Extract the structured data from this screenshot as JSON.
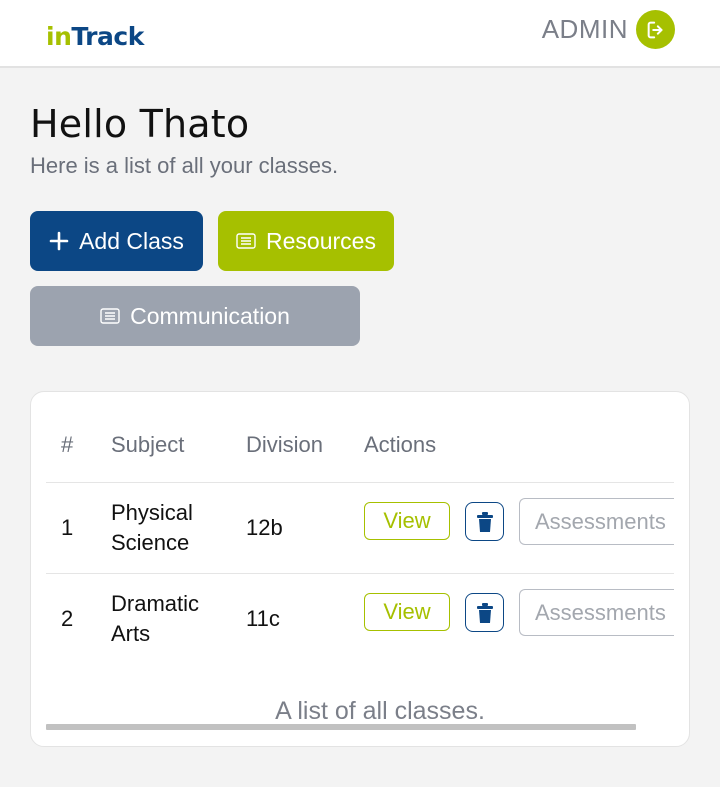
{
  "header": {
    "logo_in": "in",
    "logo_track": "Track",
    "role": "ADMIN",
    "logout_icon": "logout-icon"
  },
  "greeting": "Hello Thato",
  "subtitle": "Here is a list of all your classes.",
  "buttons": {
    "add_class": "Add Class",
    "resources": "Resources",
    "communication": "Communication"
  },
  "table": {
    "headers": [
      "#",
      "Subject",
      "Division",
      "Actions"
    ],
    "rows": [
      {
        "num": "1",
        "subject_line1": "Physical",
        "subject_line2": "Science",
        "division": "12b",
        "view": "View",
        "assessments": "Assessments"
      },
      {
        "num": "2",
        "subject_line1": "Dramatic",
        "subject_line2": "Arts",
        "division": "11c",
        "view": "View",
        "assessments": "Assessments"
      }
    ],
    "caption": "A list of all classes."
  },
  "colors": {
    "brand_blue": "#0c4785",
    "brand_green": "#a6c000",
    "muted_gray": "#9ca3af"
  }
}
